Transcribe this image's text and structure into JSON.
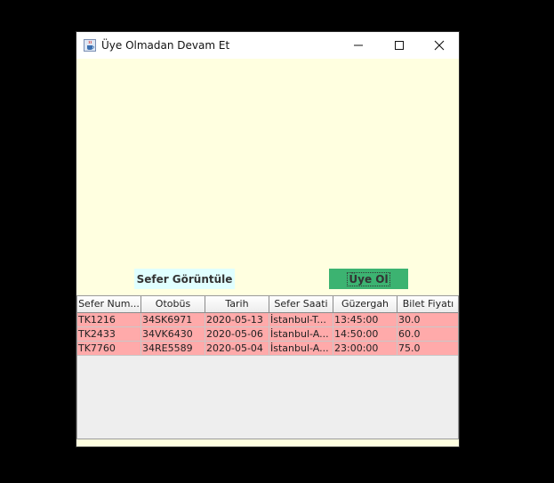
{
  "window": {
    "title": "Üye Olmadan Devam Et"
  },
  "buttons": {
    "view_trips": "Sefer Görüntüle",
    "sign_up": "Üye Ol"
  },
  "table": {
    "headers": [
      "Sefer Num...",
      "Otobüs",
      "Tarih",
      "Sefer Saati",
      "Güzergah",
      "Bilet Fiyatı"
    ],
    "rows": [
      [
        "TK1216",
        "34SK6971",
        "2020-05-13",
        "İstanbul-T...",
        "13:45:00",
        "30.0"
      ],
      [
        "TK2433",
        "34VK6430",
        "2020-05-06",
        "İstanbul-A...",
        "14:50:00",
        "60.0"
      ],
      [
        "TK7760",
        "34RE5589",
        "2020-05-04",
        "İstanbul-A...",
        "23:00:00",
        "75.0"
      ]
    ]
  },
  "colors": {
    "panel_bg": "#ffffe0",
    "view_button_bg": "#e0ffff",
    "signup_button_bg": "#3cb371",
    "row_bg": "#ffaaaa"
  },
  "icons": {
    "app": "java-cup-icon",
    "minimize": "minimize-icon",
    "maximize": "maximize-icon",
    "close": "close-icon"
  }
}
